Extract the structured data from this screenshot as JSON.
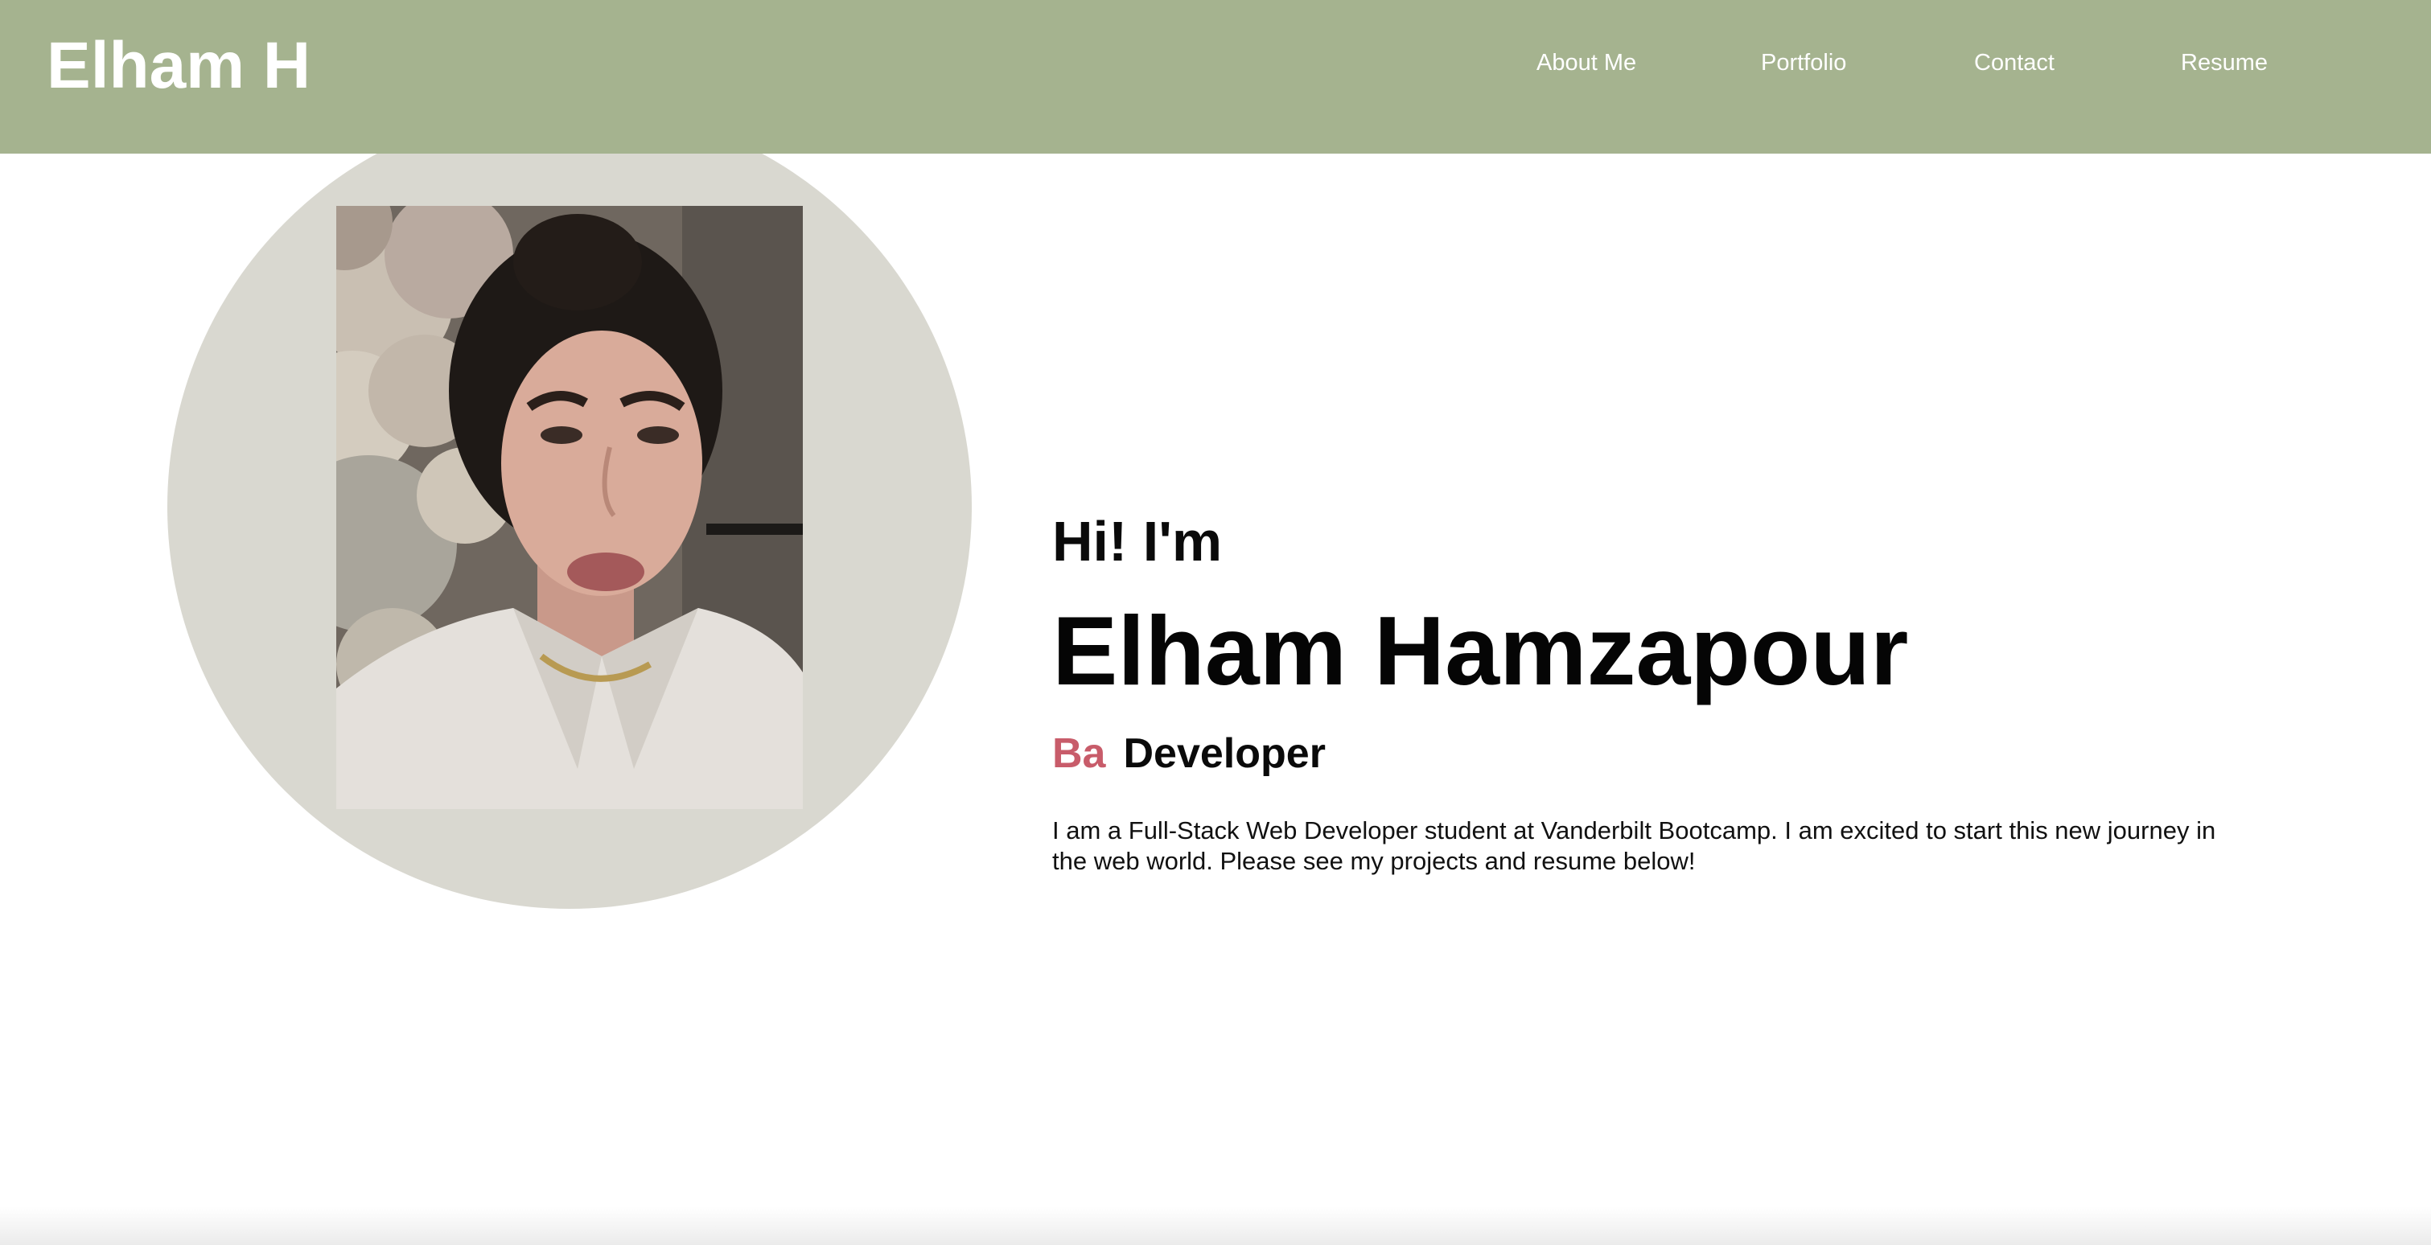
{
  "header": {
    "brand": "Elham H",
    "nav": [
      {
        "label": "About Me"
      },
      {
        "label": "Portfolio"
      },
      {
        "label": "Contact"
      },
      {
        "label": "Resume"
      }
    ]
  },
  "hero": {
    "greeting": "Hi! I'm",
    "name": "Elham Hamzapour",
    "role_typed": "Ba",
    "role_rest": "Developer",
    "bio": "I am a Full-Stack Web Developer student at Vanderbilt Bootcamp. I am excited to start this new journey in the web world. Please see my projects and resume below!"
  },
  "colors": {
    "header_bg": "#a5b38f",
    "circle_bg": "#d9d8d0",
    "accent": "#c85c6a",
    "text": "#000000"
  }
}
